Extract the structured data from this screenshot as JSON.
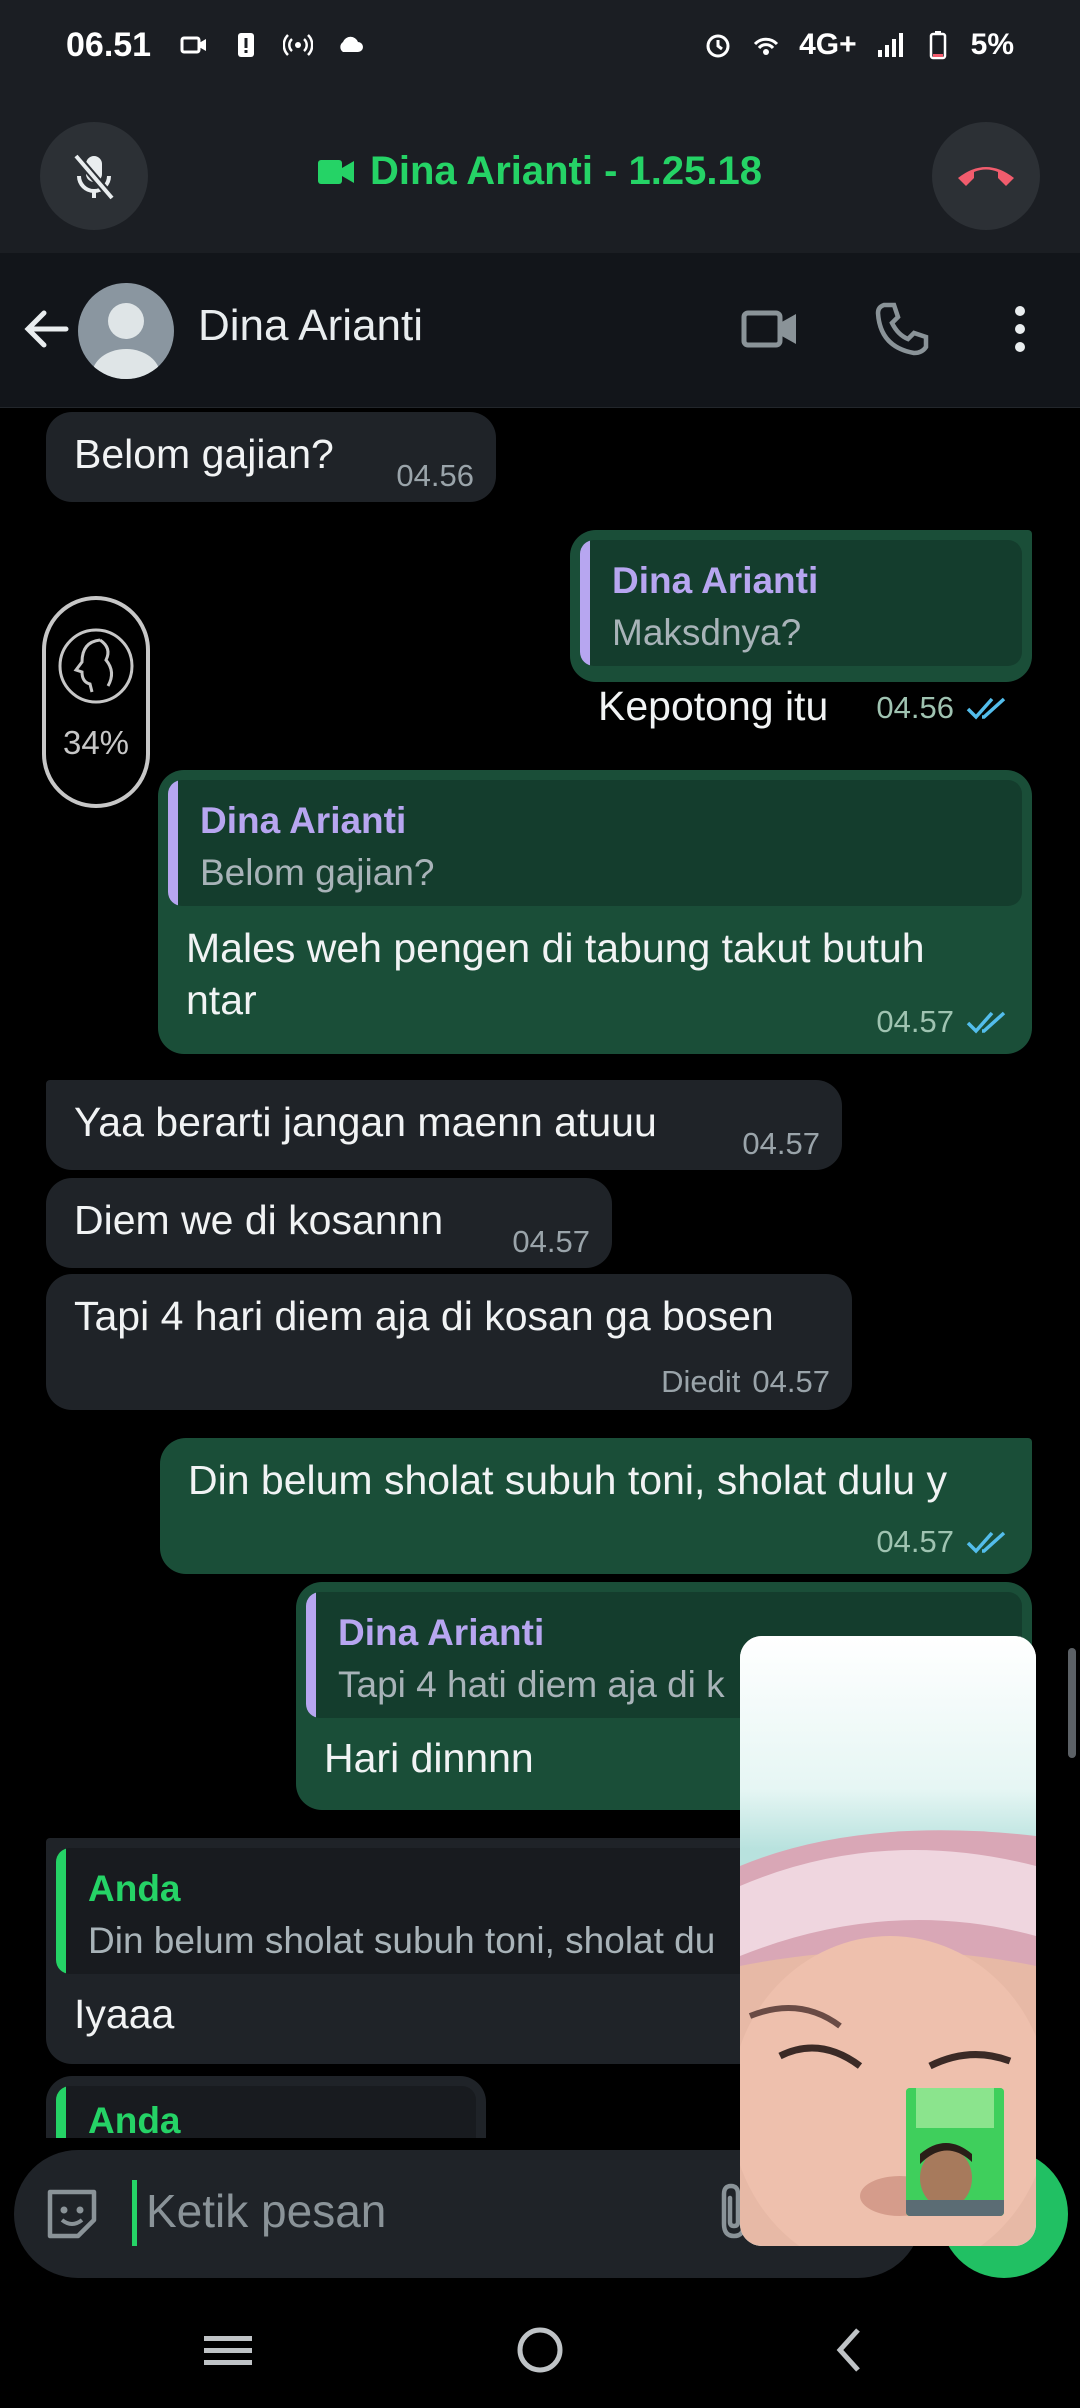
{
  "status": {
    "time": "06.51",
    "network": "4G+",
    "battery": "5%"
  },
  "call": {
    "title": "Dina Arianti - 1.25.18"
  },
  "header": {
    "contact_name": "Dina Arianti"
  },
  "battery_widget": {
    "percent": "34%"
  },
  "messages": [
    {
      "id": "m1",
      "dir": "in",
      "text": "Belom gajian?",
      "time": "04.56"
    },
    {
      "id": "m2",
      "dir": "out",
      "quote_name": "Dina Arianti",
      "quote_text": "Maksdnya?",
      "text": "Kepotong itu",
      "time": "04.56"
    },
    {
      "id": "m3",
      "dir": "out",
      "quote_name": "Dina Arianti",
      "quote_text": "Belom gajian?",
      "text_line1": "Males weh pengen di tabung takut butuh",
      "text_line2": "ntar",
      "time": "04.57"
    },
    {
      "id": "m4",
      "dir": "in",
      "text": "Yaa berarti jangan maenn atuuu",
      "time": "04.57"
    },
    {
      "id": "m5",
      "dir": "in",
      "text": "Diem we di kosannn",
      "time": "04.57"
    },
    {
      "id": "m6",
      "dir": "in",
      "text": "Tapi 4 hari diem aja di kosan ga bosen",
      "edited": "Diedit",
      "time": "04.57"
    },
    {
      "id": "m7",
      "dir": "out",
      "text": "Din belum sholat subuh toni, sholat dulu y",
      "time": "04.57"
    },
    {
      "id": "m8",
      "dir": "out",
      "quote_name": "Dina Arianti",
      "quote_text": "Tapi 4 hati diem aja di k",
      "text": "Hari dinnnn"
    },
    {
      "id": "m9",
      "dir": "in",
      "quote_name": "Anda",
      "quote_text": "Din belum sholat subuh toni, sholat du",
      "text": "Iyaaa"
    },
    {
      "id": "m10",
      "dir": "in",
      "quote_name": "Anda"
    }
  ],
  "composer": {
    "placeholder": "Ketik pesan"
  },
  "colors": {
    "accent_green": "#25d366",
    "quote_purple": "#b7a6f0",
    "read_ticks": "#53bdeb",
    "hangup_red": "#f15c6d"
  }
}
